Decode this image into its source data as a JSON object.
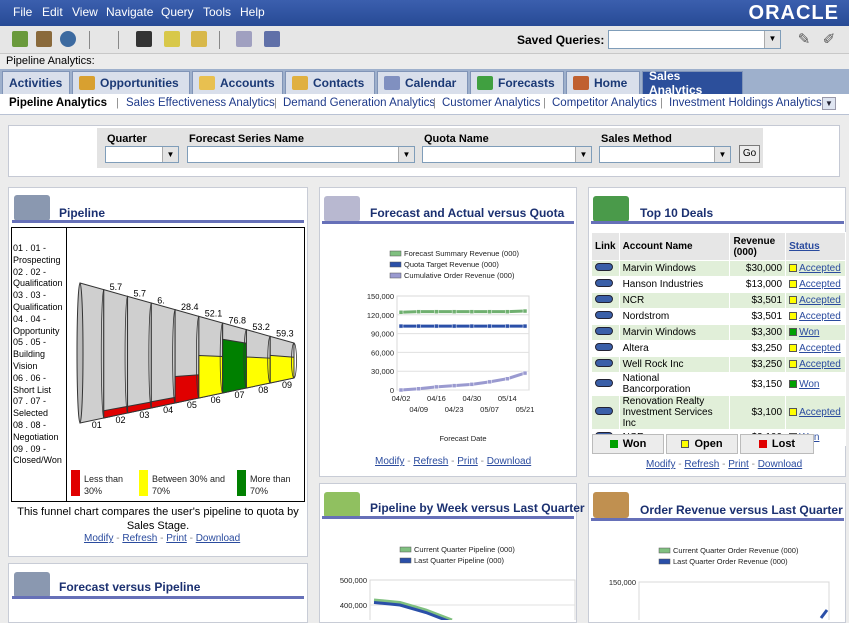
{
  "menu": [
    "File",
    "Edit",
    "View",
    "Navigate",
    "Query",
    "Tools",
    "Help"
  ],
  "brand": "ORACLE",
  "toolbar": {
    "saved_queries_label": "Saved Queries:",
    "saved_queries_value": ""
  },
  "breadcrumb": "Pipeline Analytics:",
  "tabs": [
    {
      "label": "Activities",
      "icon": "none"
    },
    {
      "label": "Opportunities",
      "icon": "coins-icon"
    },
    {
      "label": "Accounts",
      "icon": "folder-icon"
    },
    {
      "label": "Contacts",
      "icon": "contact-card-icon"
    },
    {
      "label": "Calendar",
      "icon": "calendar-icon"
    },
    {
      "label": "Forecasts",
      "icon": "chart-icon"
    },
    {
      "label": "Home",
      "icon": "home-icon"
    },
    {
      "label": "Sales Analytics",
      "icon": "none"
    }
  ],
  "subtabs": [
    "Pipeline Analytics",
    "Sales Effectiveness Analytics",
    "Demand Generation Analytics",
    "Customer Analytics",
    "Competitor Analytics",
    "Investment Holdings Analytics"
  ],
  "filters": {
    "quarter": "Quarter",
    "forecast_series": "Forecast Series Name",
    "quota_name": "Quota Name",
    "sales_method": "Sales Method",
    "go": "Go"
  },
  "pipeline": {
    "title": "Pipeline",
    "stages": [
      "01 . 01 -",
      "Prospecting",
      "02 . 02 -",
      "Qualification",
      "03 . 03 -",
      "Qualification",
      "04 . 04 -",
      "Opportunity",
      "05 . 05 -",
      "Building",
      "Vision",
      "06 . 06 -",
      "Short List",
      "07 . 07 -",
      "Selected",
      "08 . 08 -",
      "Negotiation",
      "09 . 09 -",
      "Closed/Won"
    ],
    "values": [
      "5.7",
      "5.7",
      "6.",
      "28.4",
      "52.1",
      "76.8",
      "53.2",
      "59.3"
    ],
    "xlabels": [
      "01",
      "02",
      "03",
      "04",
      "05",
      "06",
      "07",
      "08",
      "09"
    ],
    "legend": [
      "Less than 30%",
      "Between 30% and 70%",
      "More than 70%"
    ],
    "legend_lines": [
      "Less than",
      "30%",
      "Between 30% and",
      "70%",
      "More than",
      "70%"
    ],
    "colors": {
      "low": "#e00000",
      "mid": "#ffff00",
      "high": "#008000"
    },
    "description": "This funnel chart compares the user's pipeline to quota by Sales Stage."
  },
  "forecast_actual": {
    "title": "Forecast and Actual versus Quota",
    "legend": [
      "Forecast Summary Revenue (000)",
      "Quota Target Revenue (000)",
      "Cumulative Order Revenue (000)"
    ],
    "yticks": [
      "150,000",
      "120,000",
      "90,000",
      "60,000",
      "30,000",
      "0"
    ],
    "xticks_top": [
      "04/02",
      "04/16",
      "04/30",
      "05/14"
    ],
    "xticks_bottom": [
      "04/09",
      "04/23",
      "05/07",
      "05/21"
    ],
    "xlabel": "Forecast Date"
  },
  "top_deals": {
    "title": "Top 10 Deals",
    "headers": {
      "link": "Link",
      "account": "Account Name",
      "revenue": "Revenue (000)",
      "revenue_line1": "Revenue",
      "revenue_line2": "(000)",
      "status": "Status"
    },
    "rows": [
      {
        "account": "Marvin Windows",
        "revenue": "$30,000",
        "status": "Accepted"
      },
      {
        "account": "Hanson Industries",
        "revenue": "$13,000",
        "status": "Accepted"
      },
      {
        "account": "NCR",
        "revenue": "$3,501",
        "status": "Accepted"
      },
      {
        "account": "Nordstrom",
        "revenue": "$3,501",
        "status": "Accepted"
      },
      {
        "account": "Marvin Windows",
        "revenue": "$3,300",
        "status": "Won"
      },
      {
        "account": "Altera",
        "revenue": "$3,250",
        "status": "Accepted"
      },
      {
        "account": "Well Rock Inc",
        "revenue": "$3,250",
        "status": "Accepted"
      },
      {
        "account": "National Bancorporation",
        "revenue": "$3,150",
        "status": "Won"
      },
      {
        "account": "Renovation Realty Investment Services Inc",
        "revenue": "$3,100",
        "status": "Accepted"
      },
      {
        "account": "NCR",
        "revenue": "$3,100",
        "status": "Won"
      }
    ],
    "rows_display": [
      {
        "account_line1": "Renovation Realty",
        "account_line2": "Investment Services Inc"
      }
    ],
    "buttons": [
      "Won",
      "Open",
      "Lost"
    ]
  },
  "links": {
    "modify": "Modify",
    "refresh": "Refresh",
    "print": "Print",
    "download": "Download",
    "sep": " - "
  },
  "forecast_pipeline": {
    "title": "Forecast versus Pipeline"
  },
  "pipeline_week": {
    "title": "Pipeline by Week versus Last Quarter",
    "legend": [
      "Current Quarter Pipeline (000)",
      "Last Quarter Pipeline (000)"
    ],
    "yticks": [
      "500,000",
      "400,000"
    ]
  },
  "order_revenue": {
    "title": "Order Revenue versus Last Quarter",
    "legend": [
      "Current Quarter Order Revenue (000)",
      "Last Quarter Order Revenue (000)"
    ],
    "yticks": [
      "150,000",
      "120,000"
    ]
  },
  "chart_data": [
    {
      "type": "bar",
      "title": "Pipeline",
      "categories": [
        "01",
        "02",
        "03",
        "04",
        "05",
        "06",
        "07",
        "08",
        "09"
      ],
      "values": [
        null,
        5.7,
        5.7,
        6,
        28.4,
        52.1,
        76.8,
        53.2,
        59.3
      ]
    },
    {
      "type": "line",
      "title": "Forecast and Actual versus Quota",
      "xlabel": "Forecast Date",
      "x": [
        "04/02",
        "04/09",
        "04/16",
        "04/23",
        "04/30",
        "05/07",
        "05/14",
        "05/21"
      ],
      "ylim": [
        0,
        150000
      ],
      "series": [
        {
          "name": "Forecast Summary Revenue (000)",
          "values": [
            124000,
            125000,
            125000,
            125000,
            125000,
            125000,
            125000,
            126000
          ]
        },
        {
          "name": "Quota Target Revenue (000)",
          "values": [
            102000,
            102000,
            102000,
            102000,
            102000,
            102000,
            102000,
            102000
          ]
        },
        {
          "name": "Cumulative Order Revenue (000)",
          "values": [
            0,
            2000,
            5000,
            7000,
            9000,
            13000,
            18000,
            27000
          ]
        }
      ]
    },
    {
      "type": "line",
      "title": "Pipeline by Week versus Last Quarter",
      "series": [
        {
          "name": "Current Quarter Pipeline (000)",
          "values": [
            420000,
            410000,
            380000,
            340000
          ]
        },
        {
          "name": "Last Quarter Pipeline (000)",
          "values": [
            410000,
            400000,
            370000,
            330000
          ]
        }
      ]
    },
    {
      "type": "line",
      "title": "Order Revenue versus Last Quarter",
      "series": [
        {
          "name": "Current Quarter Order Revenue (000)",
          "values": []
        },
        {
          "name": "Last Quarter Order Revenue (000)",
          "values": []
        }
      ]
    }
  ]
}
